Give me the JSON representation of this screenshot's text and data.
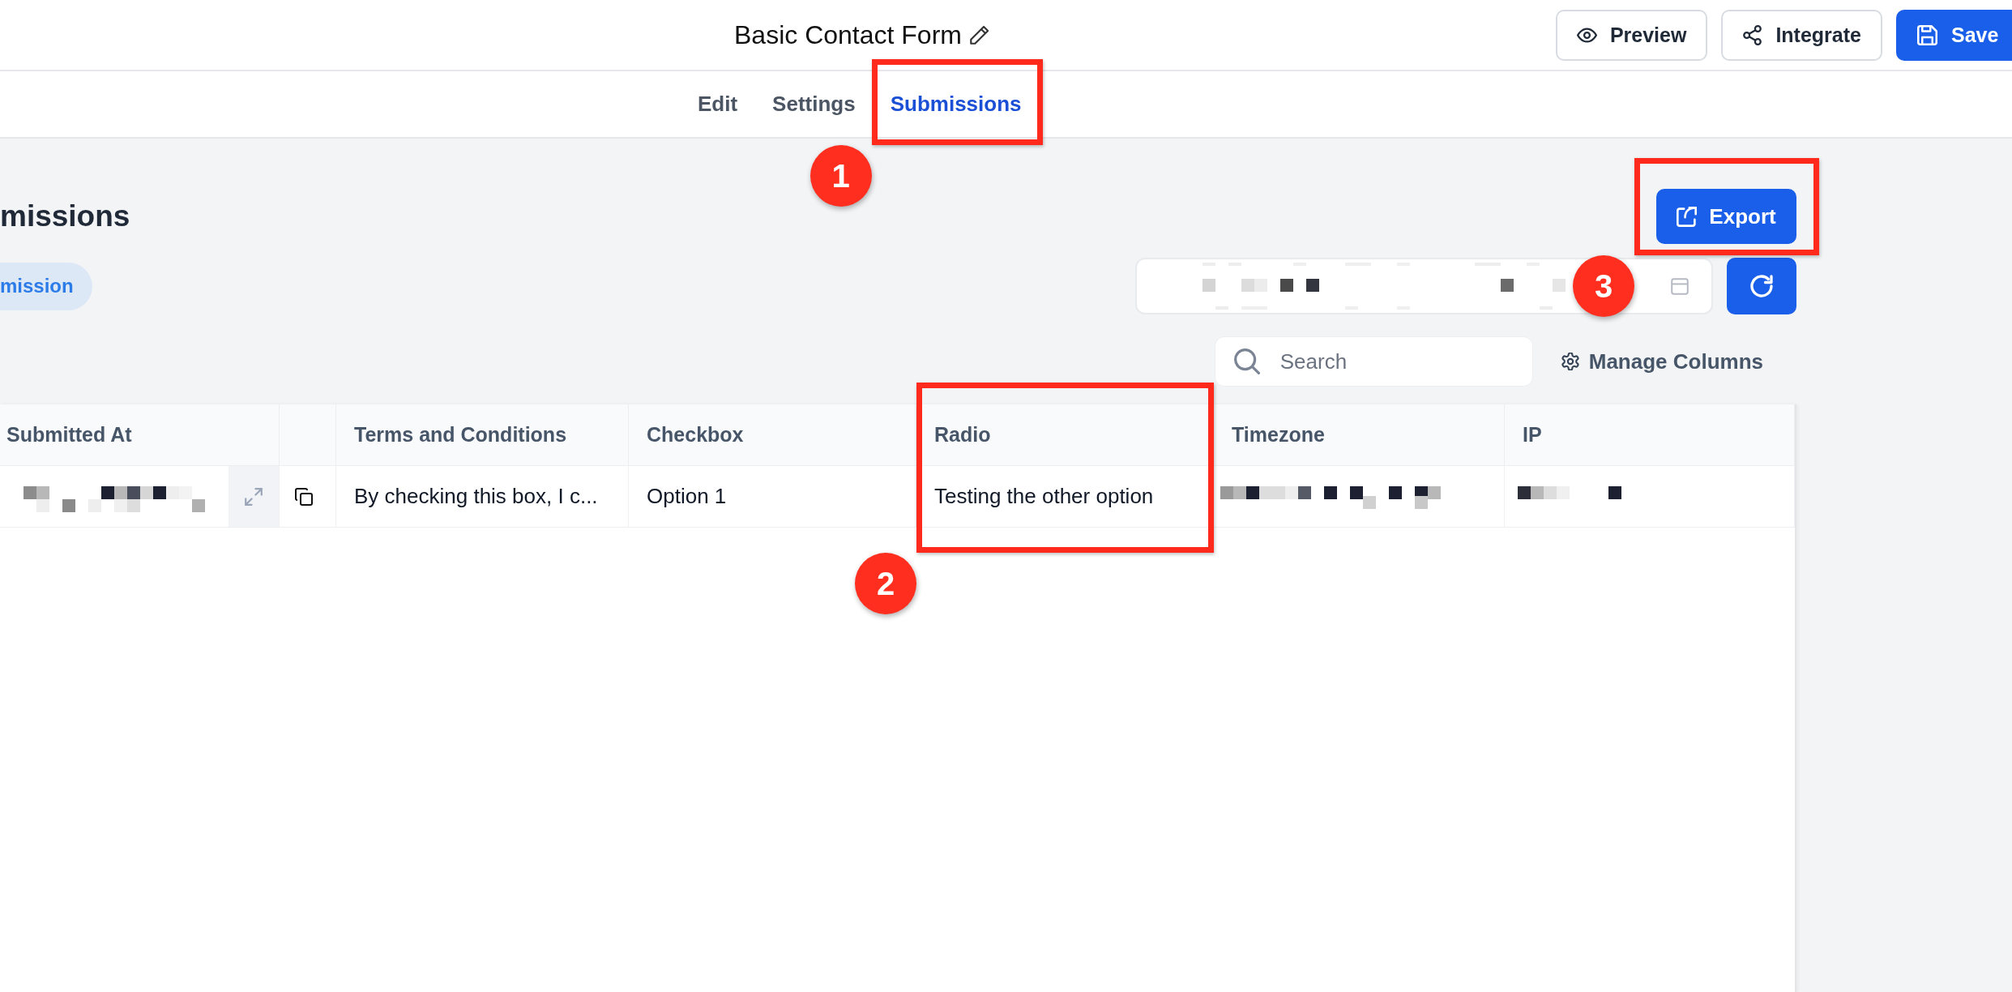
{
  "top_bar": {
    "title": "Basic Contact Form",
    "preview_button": {
      "label": "Preview"
    },
    "integrate_button": {
      "label": "Integrate"
    },
    "save_button": {
      "label": "Save"
    }
  },
  "tabs": [
    {
      "label": "Edit",
      "selected": false
    },
    {
      "label": "Settings",
      "selected": false
    },
    {
      "label": "Submissions",
      "selected": true,
      "callout": "1"
    }
  ],
  "page": {
    "heading": "missions",
    "pill": "mission",
    "export_button": {
      "label": "Export",
      "callout": "3"
    },
    "date_range": {
      "redacted": true
    },
    "search": {
      "placeholder": "Search"
    },
    "manage_columns": {
      "label": "Manage Columns"
    }
  },
  "table": {
    "columns": [
      {
        "kind": "text",
        "label": "Submitted At"
      },
      {
        "kind": "blank"
      },
      {
        "kind": "text",
        "label": "Terms and Conditions"
      },
      {
        "kind": "text",
        "label": "Checkbox"
      },
      {
        "kind": "text",
        "label": "Radio",
        "callout": "2"
      },
      {
        "kind": "text",
        "label": "Timezone"
      },
      {
        "kind": "text",
        "label": "IP"
      }
    ],
    "rows": [
      {
        "cells": [
          {
            "kind": "redacted",
            "expand_button": true
          },
          {
            "kind": "copy"
          },
          {
            "kind": "text",
            "text": "By checking this box, I c..."
          },
          {
            "kind": "text",
            "text": "Option 1"
          },
          {
            "kind": "text",
            "text": "Testing the other option"
          },
          {
            "kind": "redacted"
          },
          {
            "kind": "redacted"
          }
        ]
      }
    ]
  }
}
